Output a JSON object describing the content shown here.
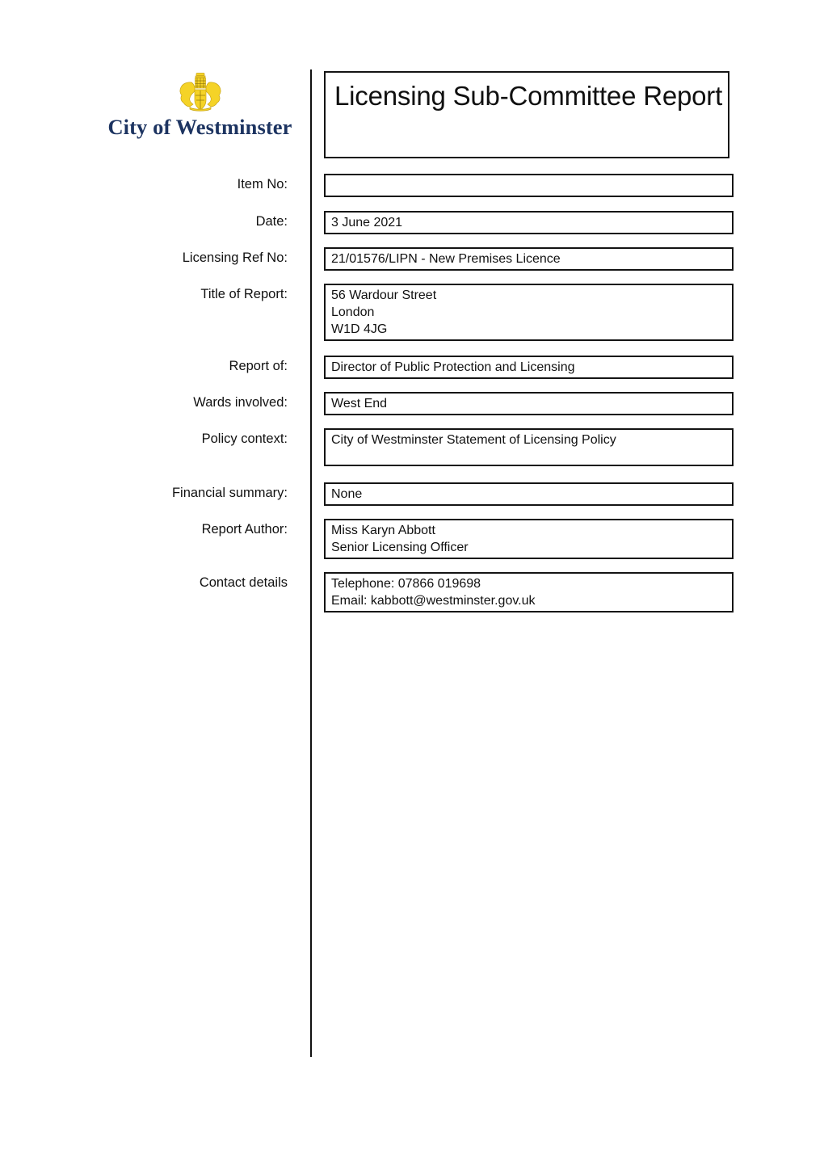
{
  "document": {
    "type": "Licensing Sub-Committee Report",
    "page_background": "#ffffff"
  },
  "masthead": {
    "crest_icon": "westminster-coat-of-arms-icon",
    "crest_color": "#F5D327",
    "council_name": "City of Westminster",
    "council_name_color": "#1d3461"
  },
  "header": {
    "title": "Licensing Sub-Committee Report"
  },
  "form": {
    "rows": [
      {
        "key": "item_no",
        "label": "Item No:",
        "lines": [
          ""
        ],
        "size": "single"
      },
      {
        "key": "date",
        "label": "Date:",
        "lines": [
          "3 June 2021"
        ],
        "size": "single"
      },
      {
        "key": "licensing_ref_no",
        "label": "Licensing Ref No:",
        "lines": [
          "21/01576/LIPN - New Premises Licence"
        ],
        "size": "single"
      },
      {
        "key": "title_of_report",
        "label": "Title of Report:",
        "lines": [
          "56 Wardour Street",
          "London",
          "W1D 4JG"
        ],
        "size": "triple"
      },
      {
        "key": "report_of",
        "label": "Report of:",
        "lines": [
          "Director of Public Protection and Licensing"
        ],
        "size": "single"
      },
      {
        "key": "wards_involved",
        "label": "Wards involved:",
        "lines": [
          "West End"
        ],
        "size": "single"
      },
      {
        "key": "policy_context",
        "label": "Policy context:",
        "lines": [
          "City of Westminster Statement of Licensing Policy"
        ],
        "size": "double"
      },
      {
        "key": "financial_summary",
        "label": "Financial summary:",
        "lines": [
          "None"
        ],
        "size": "single"
      },
      {
        "key": "report_author",
        "label": "Report Author:",
        "lines": [
          "Miss Karyn Abbott",
          "Senior Licensing Officer"
        ],
        "size": "double"
      },
      {
        "key": "contact_details",
        "label": "Contact details",
        "lines": [
          "Telephone: 07866 019698",
          "Email: kabbott@westminster.gov.uk"
        ],
        "size": "double"
      }
    ]
  }
}
